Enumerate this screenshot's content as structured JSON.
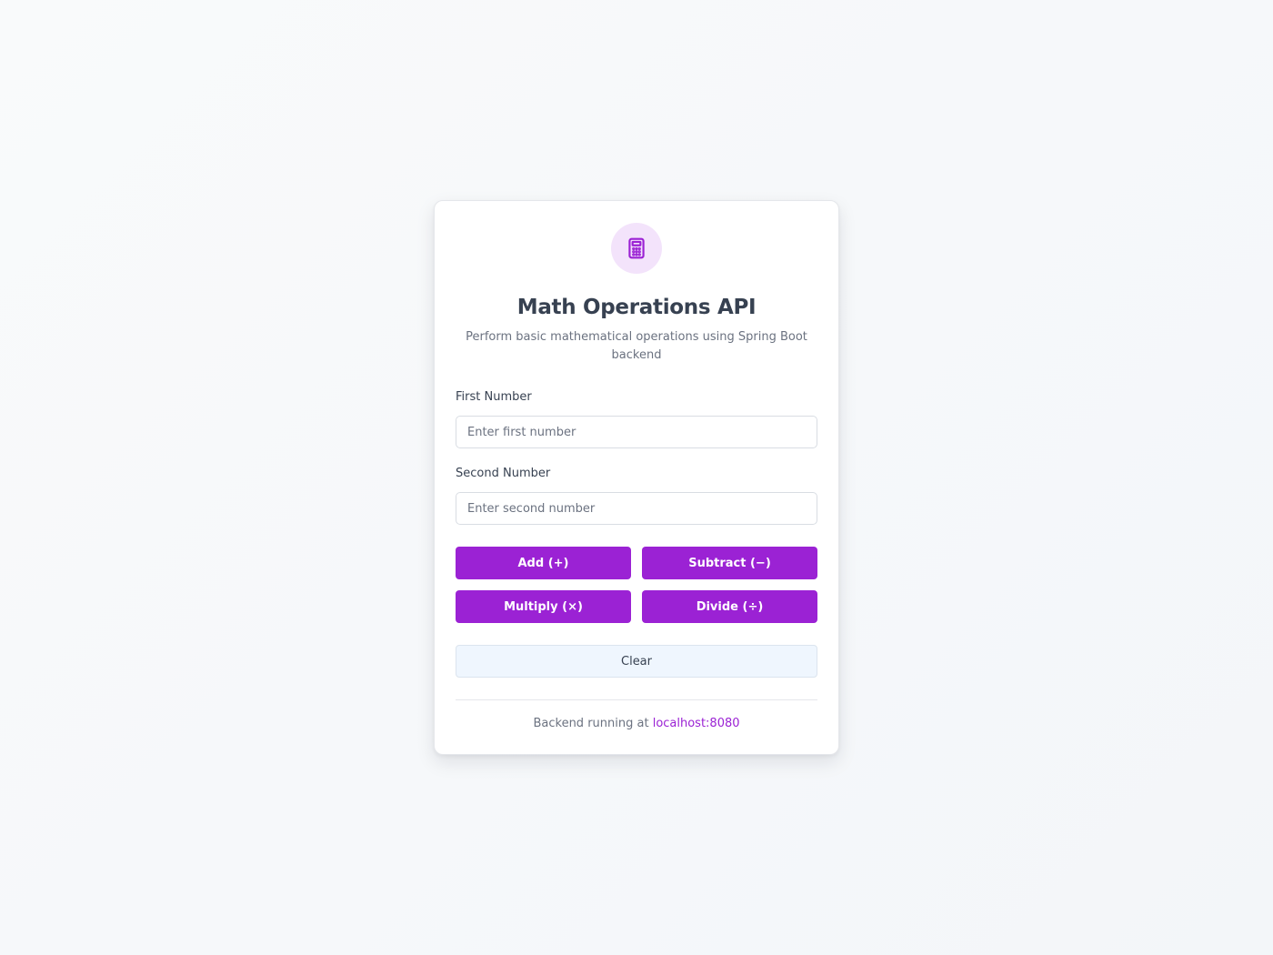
{
  "header": {
    "icon": "calculator-icon",
    "title": "Math Operations API",
    "subtitle": "Perform basic mathematical operations using Spring Boot backend"
  },
  "form": {
    "first": {
      "label": "First Number",
      "placeholder": "Enter first number",
      "value": ""
    },
    "second": {
      "label": "Second Number",
      "placeholder": "Enter second number",
      "value": ""
    }
  },
  "operations": {
    "add": "Add (+)",
    "subtract": "Subtract (−)",
    "multiply": "Multiply (×)",
    "divide": "Divide (÷)"
  },
  "clear_label": "Clear",
  "footer": {
    "prefix": "Backend running at",
    "link": "localhost:8080"
  },
  "colors": {
    "accent": "#9b22d4",
    "icon_bg": "#f3e3fb",
    "clear_bg": "#eff6fe",
    "page_bg": "#f6f8fa"
  }
}
